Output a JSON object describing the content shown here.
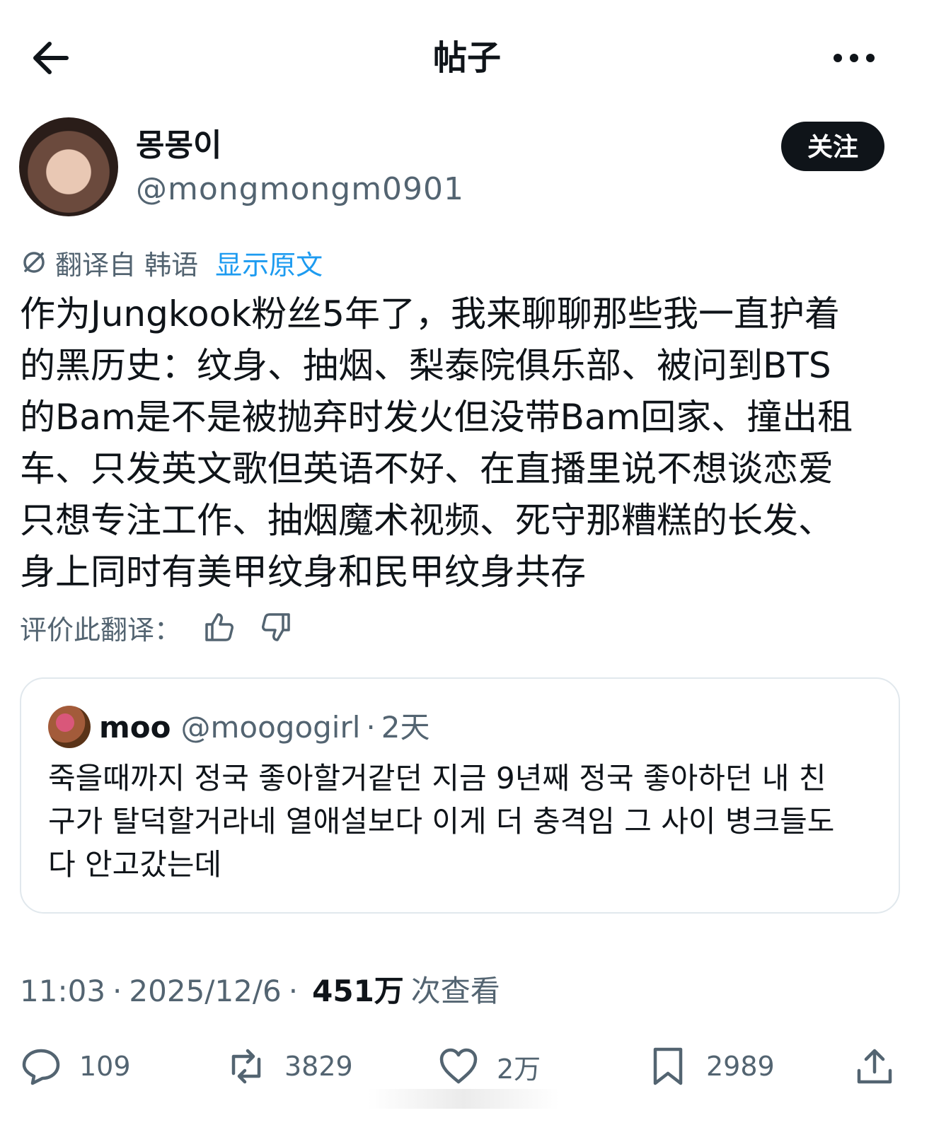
{
  "header": {
    "title": "帖子"
  },
  "author": {
    "display_name": "몽몽이",
    "handle": "@mongmongm0901",
    "follow_label": "关注"
  },
  "translation": {
    "label": "翻译自 韩语",
    "show_original": "显示原文"
  },
  "post": {
    "text": "作为Jungkook粉丝5年了，我来聊聊那些我一直护着\n的黑历史：纹身、抽烟、梨泰院俱乐部、被问到BTS\n的Bam是不是被抛弃时发火但没带Bam回家、撞出租\n车、只发英文歌但英语不好、在直播里说不想谈恋爱\n只想专注工作、抽烟魔术视频、死守那糟糕的长发、\n身上同时有美甲纹身和民甲纹身共存"
  },
  "rate": {
    "label": "评价此翻译："
  },
  "quote": {
    "name": "moo",
    "handle": "@moogogirl",
    "dot": "·",
    "time": "2天",
    "text": "죽을때까지 정국 좋아할거같던 지금 9년째 정국 좋아하던 내 친\n구가 탈덕할거라네 열애설보다 이게 더 충격임 그 사이 병크들도\n다 안고갔는데"
  },
  "meta": {
    "time": "11:03",
    "sep": "·",
    "date": "2025/12/6",
    "views": "451万",
    "views_label": "次查看"
  },
  "actions": {
    "replies": "109",
    "reposts": "3829",
    "likes": "2万",
    "bookmarks": "2989"
  },
  "icons": [
    "back-arrow-icon",
    "more-icon",
    "translate-icon",
    "thumbs-up-icon",
    "thumbs-down-icon",
    "reply-icon",
    "repost-icon",
    "like-icon",
    "bookmark-icon",
    "share-icon"
  ]
}
